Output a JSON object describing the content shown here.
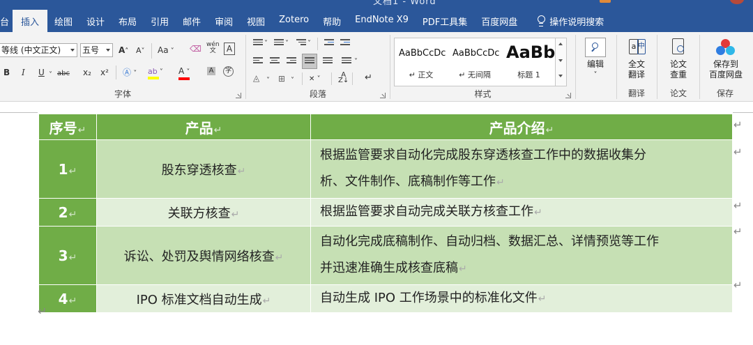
{
  "window": {
    "title_fragment": "文档1 - Word"
  },
  "tabs": {
    "first": "台",
    "active": "插入",
    "items": [
      "绘图",
      "设计",
      "布局",
      "引用",
      "邮件",
      "审阅",
      "视图",
      "Zotero",
      "帮助",
      "EndNote X9",
      "PDF工具集",
      "百度网盘"
    ],
    "help": "操作说明搜索"
  },
  "ribbon": {
    "font": {
      "name": "等线 (中文正文)",
      "size": "五号",
      "grow": "A",
      "shrink": "A",
      "case": "Aa",
      "pinyin": "wén",
      "bold": "B",
      "italic": "I",
      "underline": "U",
      "strike": "abc",
      "subscript": "x₂",
      "superscript": "x²",
      "label": "字体"
    },
    "paragraph": {
      "label": "段落"
    },
    "styles": {
      "label": "样式",
      "items": [
        {
          "sample": "AaBbCcDc",
          "name": "↵ 正文"
        },
        {
          "sample": "AaBbCcDc",
          "name": "↵ 无间隔"
        },
        {
          "sample": "AaBb",
          "name": "标题 1"
        }
      ]
    },
    "editing": {
      "label": "编辑"
    },
    "translate": {
      "button": "全文\n翻译",
      "label": "翻译"
    },
    "paper": {
      "button": "论文\n查重",
      "label": "论文"
    },
    "save": {
      "button": "保存到\n百度网盘",
      "label": "保存"
    },
    "colors": {
      "accent": "#2b579a",
      "highlight": "#ffff00",
      "font_red": "#ff0000"
    }
  },
  "document": {
    "table": {
      "headers": [
        "序号",
        "产品",
        "产品介绍"
      ],
      "rows": [
        {
          "num": "1",
          "product": "股东穿透核查",
          "desc_lines": [
            "根据监管要求自动化完成股东穿透核查工作中的数据收集分",
            "析、文件制作、底稿制作等工作"
          ]
        },
        {
          "num": "2",
          "product": "关联方核查",
          "desc_lines": [
            "根据监管要求自动完成关联方核查工作"
          ]
        },
        {
          "num": "3",
          "product": "诉讼、处罚及舆情网络核查",
          "desc_lines": [
            "自动化完成底稿制作、自动归档、数据汇总、详情预览等工作",
            "并迅速准确生成核查底稿"
          ]
        },
        {
          "num": "4",
          "product": "IPO 标准文档自动生成",
          "desc_lines": [
            "自动生成 IPO 工作场景中的标准化文件"
          ]
        }
      ],
      "colors": {
        "header": "#70ad47",
        "row_dark": "#c6e0b4",
        "row_light": "#e2efda"
      }
    },
    "para_mark": "↵"
  }
}
